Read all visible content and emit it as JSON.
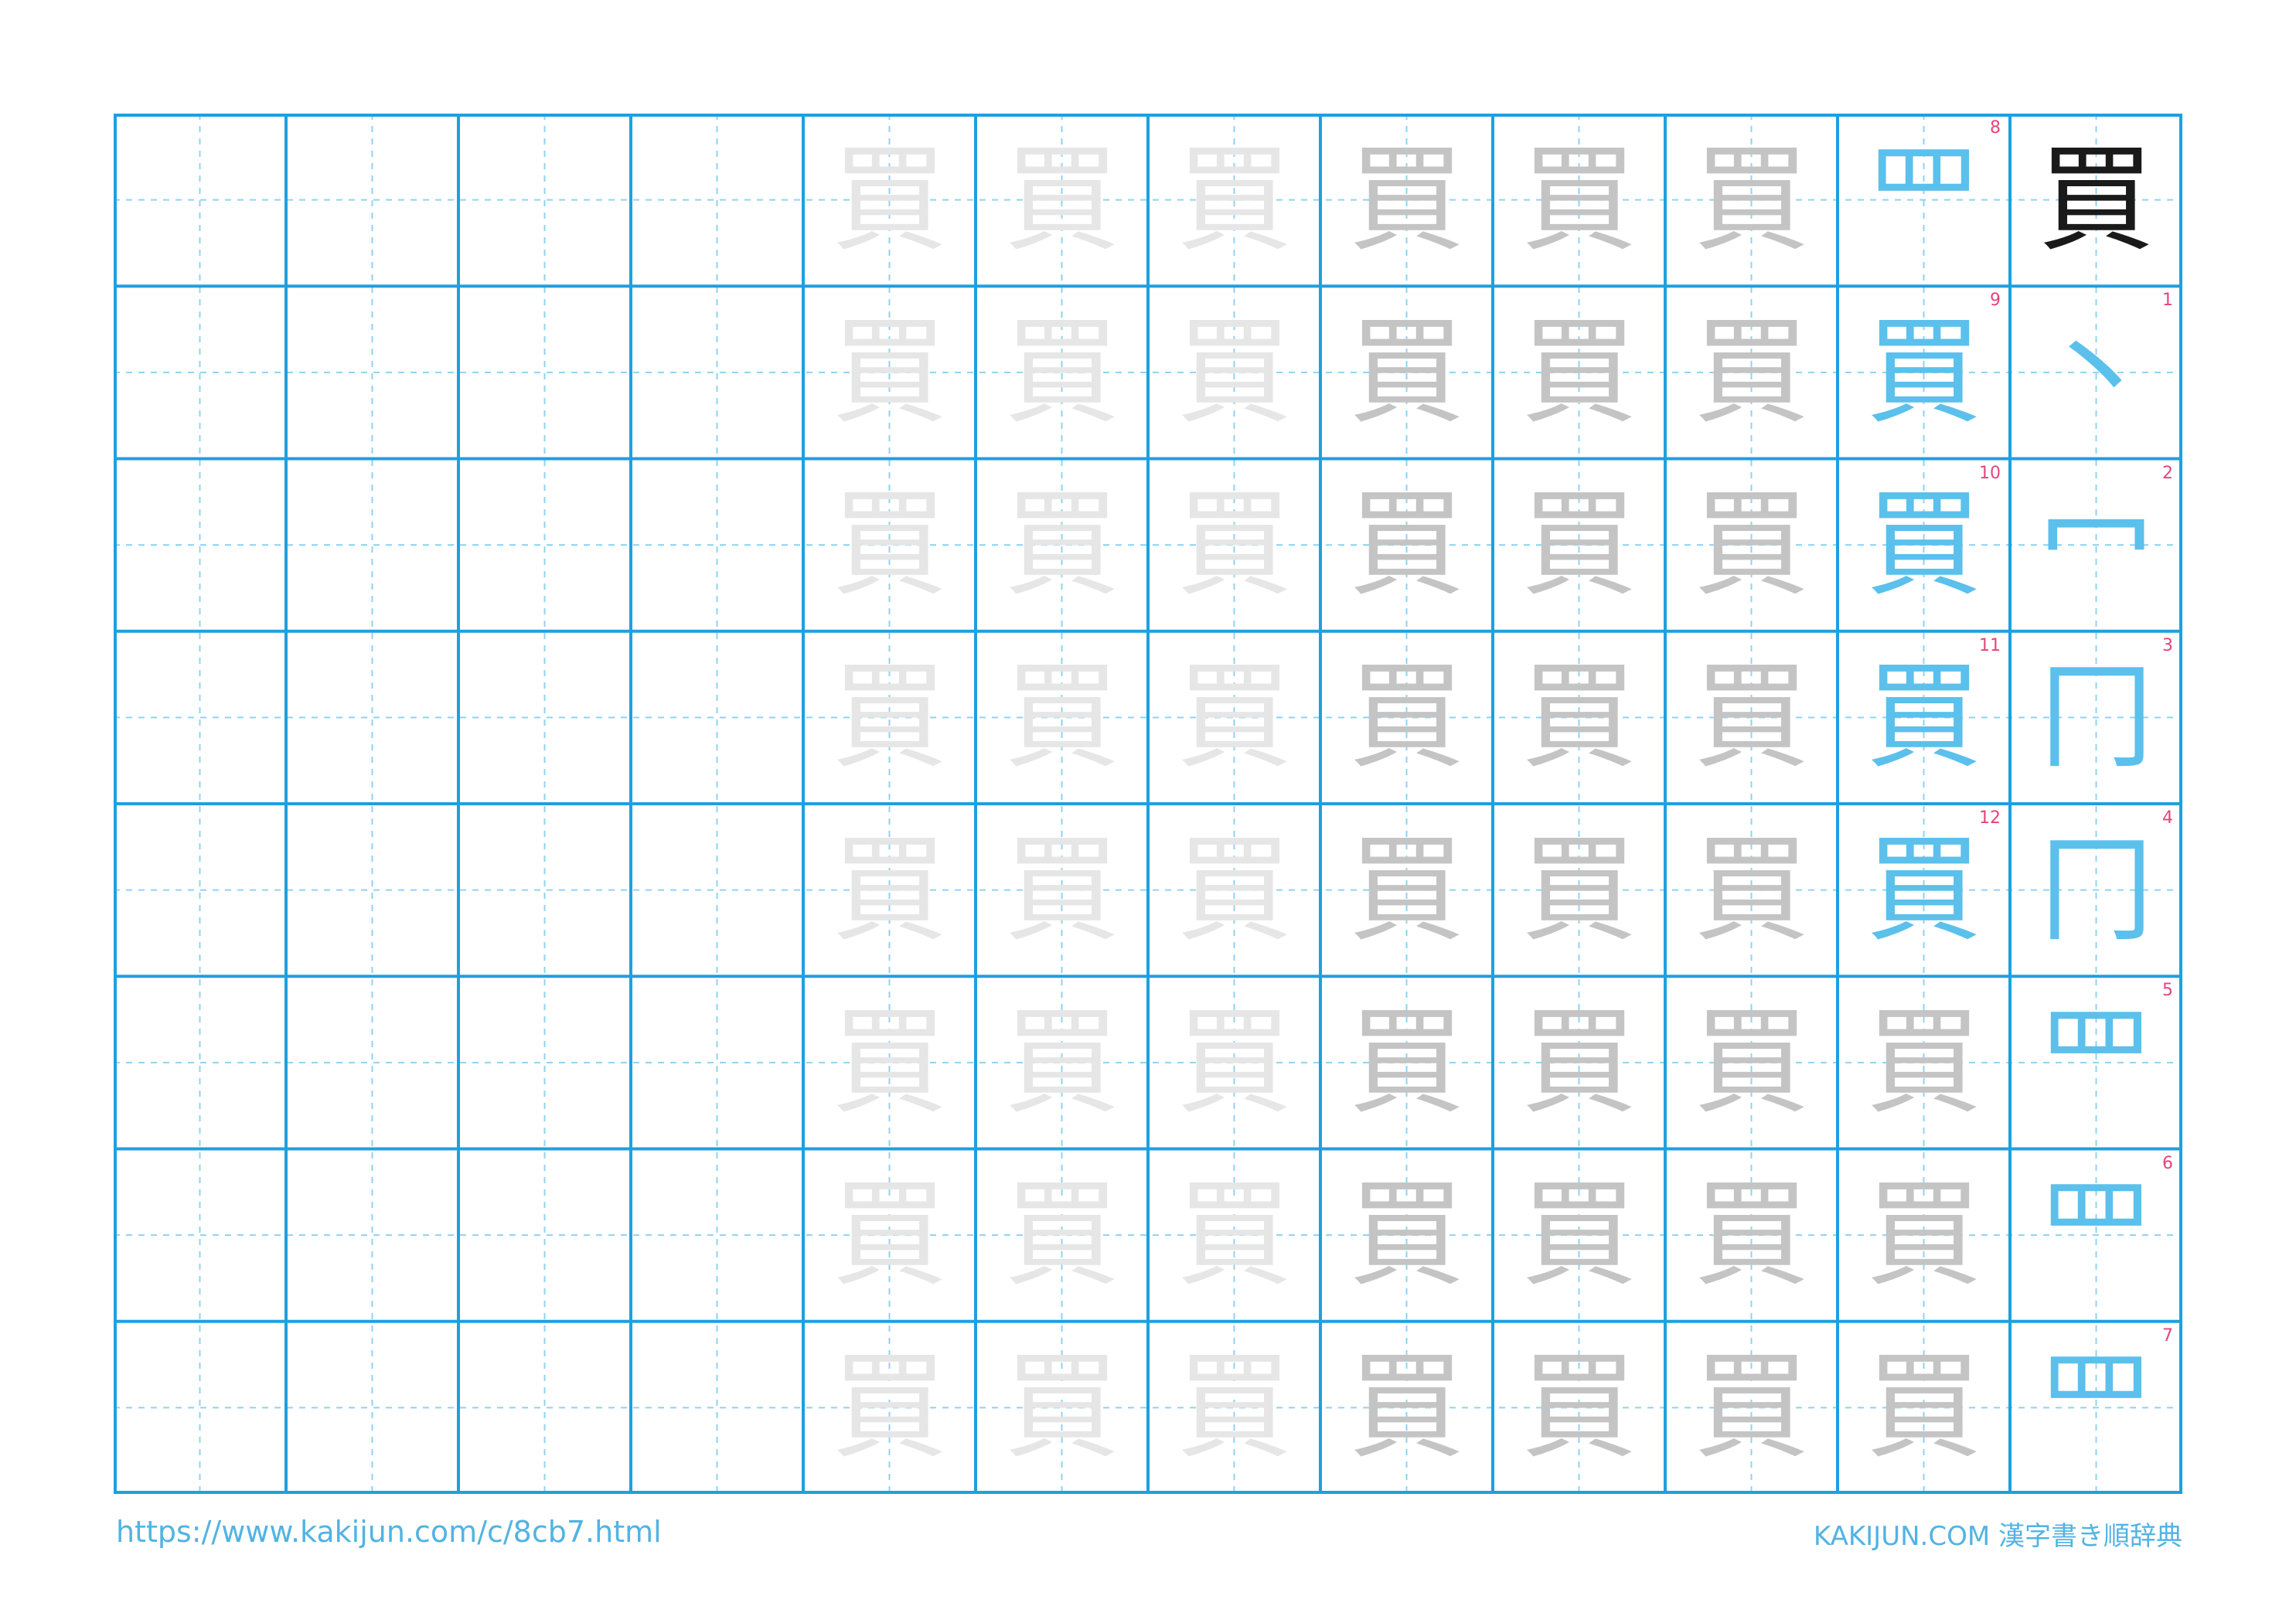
{
  "worksheet": {
    "kanji": "買",
    "columns": 12,
    "rows": 8,
    "stroke_steps": [
      {
        "n": "1",
        "glyph": "丶"
      },
      {
        "n": "2",
        "glyph": "冖"
      },
      {
        "n": "3",
        "glyph": "冂"
      },
      {
        "n": "4",
        "glyph": "冂"
      },
      {
        "n": "5",
        "glyph": "罒"
      },
      {
        "n": "6",
        "glyph": "罒"
      },
      {
        "n": "7",
        "glyph": "罒"
      },
      {
        "n": "8",
        "glyph": "罒"
      },
      {
        "n": "9",
        "glyph": "買"
      },
      {
        "n": "10",
        "glyph": "買"
      },
      {
        "n": "11",
        "glyph": "買"
      },
      {
        "n": "12",
        "glyph": "買"
      }
    ],
    "colors": {
      "grid": "#1ea0df",
      "guide": "#8fd3f2",
      "stroke_number": "#e5457a",
      "active_stroke": "#5bc0eb",
      "trace_dark": "#c4c4c4",
      "trace_light": "#e6e6e6"
    }
  },
  "footer": {
    "url": "https://www.kakijun.com/c/8cb7.html",
    "brand": "KAKIJUN.COM 漢字書き順辞典"
  }
}
